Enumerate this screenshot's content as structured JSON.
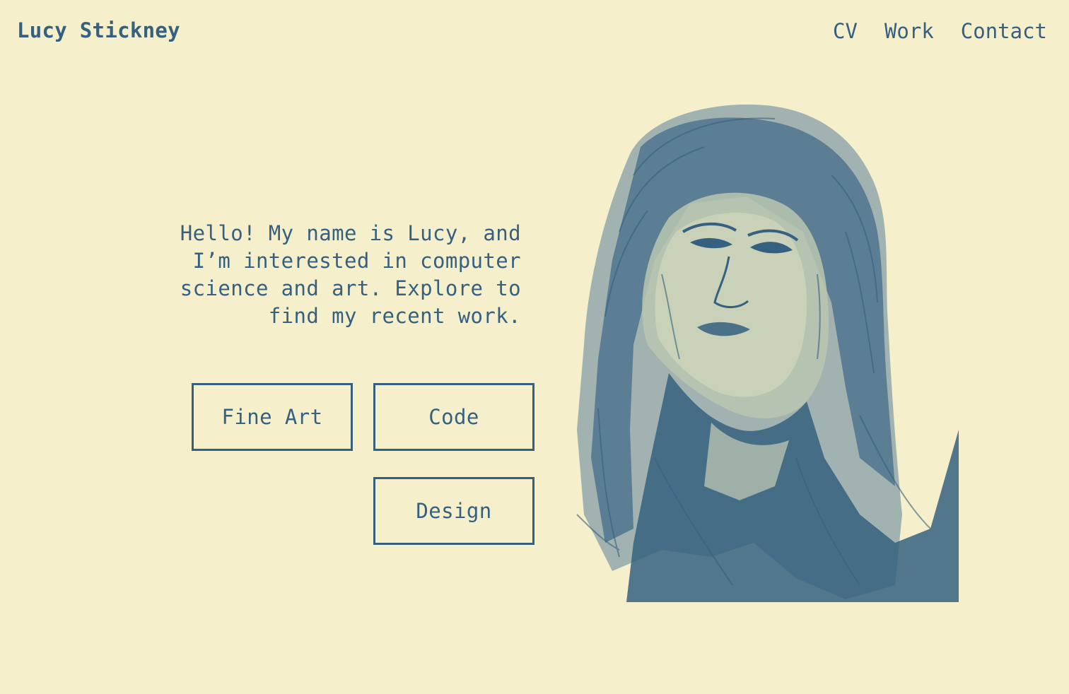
{
  "header": {
    "site_name": "Lucy Stickney",
    "nav": [
      {
        "label": "CV"
      },
      {
        "label": "Work"
      },
      {
        "label": "Contact"
      }
    ]
  },
  "main": {
    "intro_text": "Hello! My name is Lucy, and I’m interested in computer science and art. Explore to find my recent work.",
    "buttons": [
      {
        "label": "Fine Art"
      },
      {
        "label": "Code"
      },
      {
        "label": "Design"
      }
    ]
  },
  "colors": {
    "background": "#f6efcc",
    "accent": "#35607f"
  },
  "icons": {
    "portrait": "portrait-illustration"
  }
}
